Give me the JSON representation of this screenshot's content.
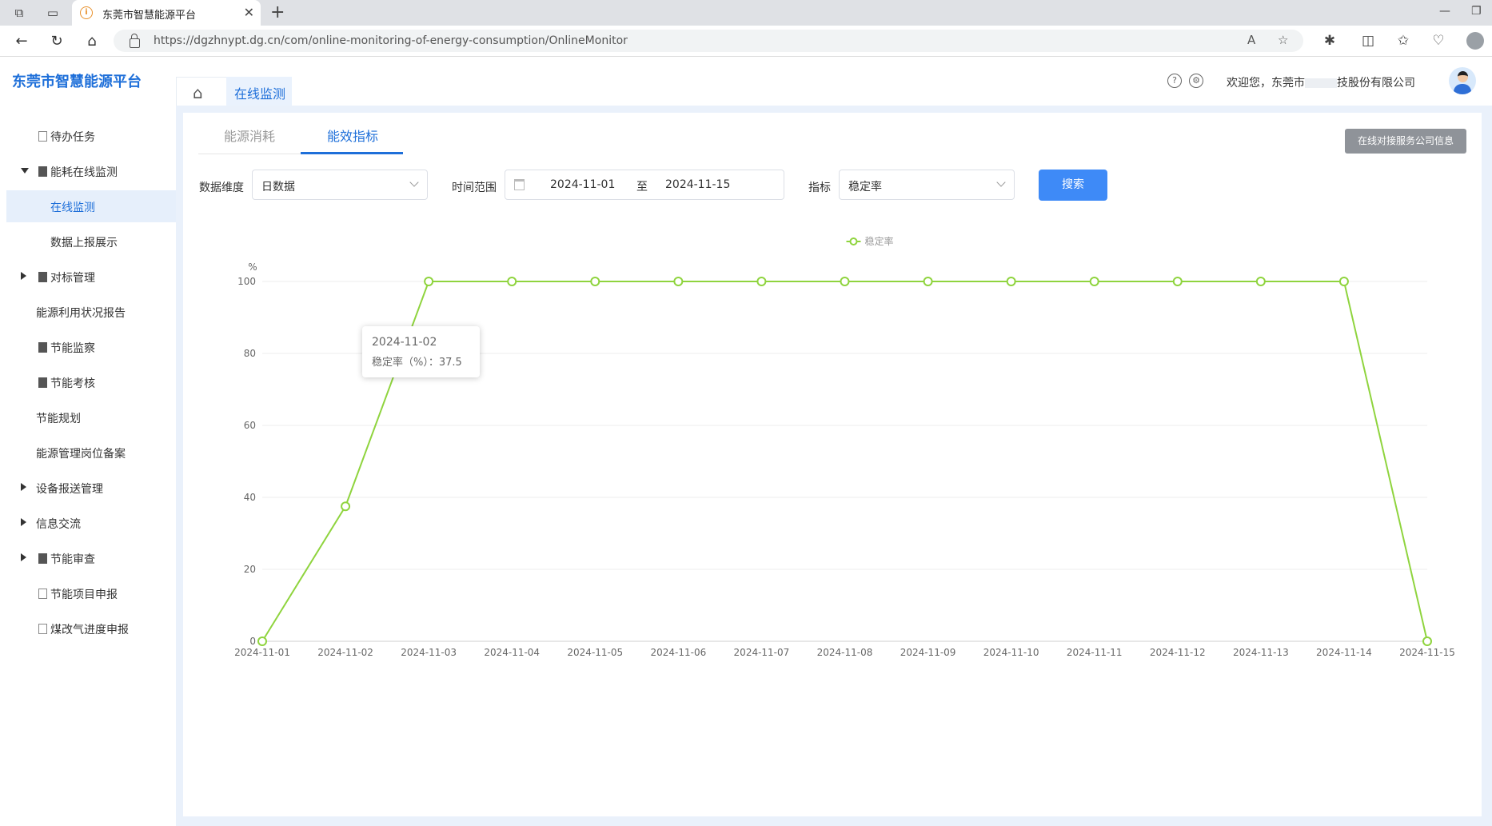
{
  "browser": {
    "tab_title": "东莞市智慧能源平台",
    "url": "https://dgzhnypt.dg.cn/com/online-monitoring-of-energy-consumption/OnlineMonitor"
  },
  "app": {
    "logo": "东莞市智慧能源平台",
    "breadcrumb_tab": "在线监测",
    "welcome_prefix": "欢迎您，东莞市",
    "welcome_suffix": "技股份有限公司"
  },
  "sidebar": {
    "items": [
      {
        "label": "待办任务",
        "arrow": "",
        "icon": "doc"
      },
      {
        "label": "能耗在线监测",
        "arrow": "down",
        "icon": "doc-filled"
      },
      {
        "label": "在线监测",
        "arrow": "",
        "icon": "",
        "active": true
      },
      {
        "label": "数据上报展示",
        "arrow": "",
        "icon": ""
      },
      {
        "label": "对标管理",
        "arrow": "right",
        "icon": "doc-filled"
      },
      {
        "label": "能源利用状况报告",
        "arrow": "",
        "icon": ""
      },
      {
        "label": "节能监察",
        "arrow": "",
        "icon": "doc-filled"
      },
      {
        "label": "节能考核",
        "arrow": "",
        "icon": "doc-filled"
      },
      {
        "label": "节能规划",
        "arrow": "",
        "icon": ""
      },
      {
        "label": "能源管理岗位备案",
        "arrow": "",
        "icon": ""
      },
      {
        "label": "设备报送管理",
        "arrow": "right",
        "icon": ""
      },
      {
        "label": "信息交流",
        "arrow": "right",
        "icon": ""
      },
      {
        "label": "节能审查",
        "arrow": "right",
        "icon": "doc-filled"
      },
      {
        "label": "节能项目申报",
        "arrow": "",
        "icon": "doc"
      },
      {
        "label": "煤改气进度申报",
        "arrow": "",
        "icon": "doc"
      }
    ]
  },
  "main": {
    "tabs": [
      "能源消耗",
      "能效指标"
    ],
    "active_tab": "能效指标",
    "service_button": "在线对接服务公司信息",
    "filters": {
      "dimension_label": "数据维度",
      "dimension_value": "日数据",
      "range_label": "时间范围",
      "range_start": "2024-11-01",
      "range_sep": "至",
      "range_end": "2024-11-15",
      "indicator_label": "指标",
      "indicator_value": "稳定率"
    },
    "search_button": "搜索",
    "tooltip": {
      "date": "2024-11-02",
      "text": "稳定率（%）：37.5"
    }
  },
  "chart_data": {
    "type": "line",
    "x": [
      "2024-11-01",
      "2024-11-02",
      "2024-11-03",
      "2024-11-04",
      "2024-11-05",
      "2024-11-06",
      "2024-11-07",
      "2024-11-08",
      "2024-11-09",
      "2024-11-10",
      "2024-11-11",
      "2024-11-12",
      "2024-11-13",
      "2024-11-14",
      "2024-11-15"
    ],
    "series": [
      {
        "name": "稳定率",
        "color": "#8fd43e",
        "values": [
          0,
          37.5,
          100,
          100,
          100,
          100,
          100,
          100,
          100,
          100,
          100,
          100,
          100,
          100,
          0
        ]
      }
    ],
    "ylabel": "%",
    "ylim": [
      0,
      100
    ],
    "yticks": [
      0,
      20,
      40,
      60,
      80,
      100
    ],
    "legend": "top-center",
    "grid": true
  }
}
